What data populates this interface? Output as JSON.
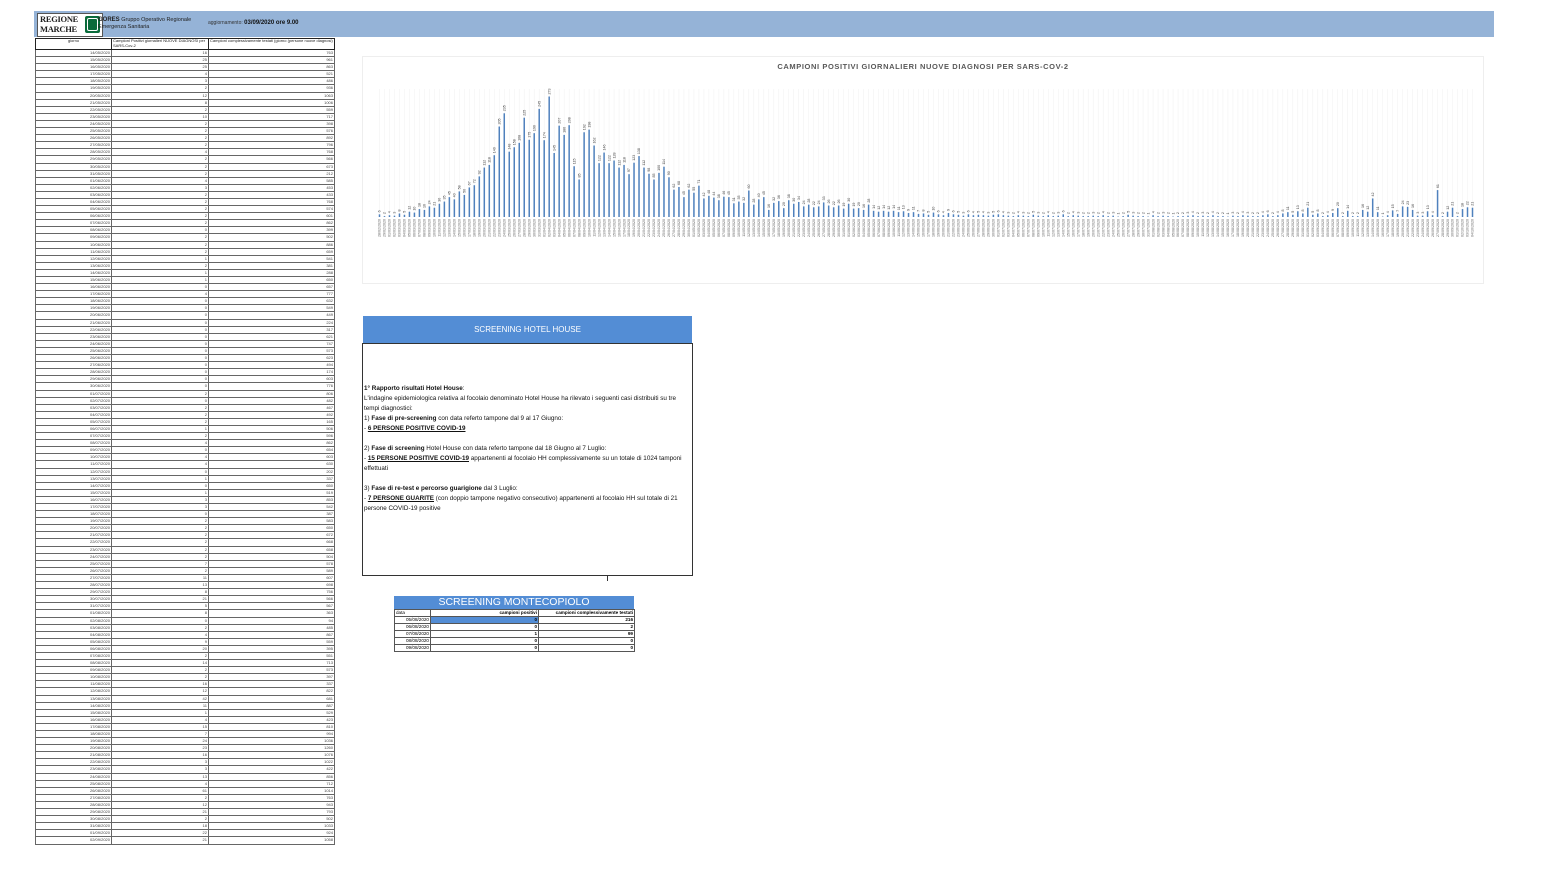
{
  "header": {
    "logo_line1": "REGIONE",
    "logo_line2": "MARCHE",
    "org_name": "GORES",
    "org_desc_1": "Gruppo Operativo Regionale",
    "org_desc_2": "Emergenza Sanitaria",
    "update_label": "aggiornamento:",
    "update_value": "03/09/2020 ore 9.00",
    "accent": "#95b3d7"
  },
  "daily_table": {
    "headers": [
      "giorno",
      "Campioni Positivi giornalieri NUOVE DIAGNOSI per SARS-Cov-2",
      "Campioni complessivamente testati (giorno (persone nuove diagnosi)"
    ],
    "rows": [
      [
        "14/05/2020",
        "16",
        "763"
      ],
      [
        "15/05/2020",
        "25",
        "961"
      ],
      [
        "16/05/2020",
        "25",
        "863"
      ],
      [
        "17/05/2020",
        "4",
        "521"
      ],
      [
        "18/05/2020",
        "3",
        "486"
      ],
      [
        "19/05/2020",
        "2",
        "936"
      ],
      [
        "20/05/2020",
        "12",
        "1063"
      ],
      [
        "21/05/2020",
        "8",
        "1006"
      ],
      [
        "22/05/2020",
        "2",
        "559"
      ],
      [
        "23/05/2020",
        "10",
        "717"
      ],
      [
        "24/05/2020",
        "2",
        "398"
      ],
      [
        "25/05/2020",
        "2",
        "576"
      ],
      [
        "26/05/2020",
        "2",
        "892"
      ],
      [
        "27/05/2020",
        "2",
        "796"
      ],
      [
        "28/05/2020",
        "4",
        "768"
      ],
      [
        "29/05/2020",
        "2",
        "566"
      ],
      [
        "30/05/2020",
        "2",
        "673"
      ],
      [
        "31/05/2020",
        "2",
        "212"
      ],
      [
        "01/06/2020",
        "4",
        "585"
      ],
      [
        "02/06/2020",
        "3",
        "453"
      ],
      [
        "03/06/2020",
        "2",
        "433"
      ],
      [
        "04/06/2020",
        "2",
        "768"
      ],
      [
        "05/06/2020",
        "2",
        "574"
      ],
      [
        "06/06/2020",
        "2",
        "601"
      ],
      [
        "07/06/2020",
        "2",
        "862"
      ],
      [
        "08/06/2020",
        "0",
        "399"
      ],
      [
        "09/06/2020",
        "2",
        "502"
      ],
      [
        "10/06/2020",
        "2",
        "886"
      ],
      [
        "11/06/2020",
        "2",
        "659"
      ],
      [
        "12/06/2020",
        "1",
        "541"
      ],
      [
        "13/06/2020",
        "2",
        "381"
      ],
      [
        "14/06/2020",
        "1",
        "288"
      ],
      [
        "15/06/2020",
        "1",
        "650"
      ],
      [
        "16/06/2020",
        "0",
        "657"
      ],
      [
        "17/06/2020",
        "4",
        "777"
      ],
      [
        "18/06/2020",
        "0",
        "632"
      ],
      [
        "19/06/2020",
        "0",
        "549"
      ],
      [
        "20/06/2020",
        "0",
        "449"
      ],
      [
        "21/06/2020",
        "0",
        "224"
      ],
      [
        "22/06/2020",
        "0",
        "317"
      ],
      [
        "23/06/2020",
        "0",
        "621"
      ],
      [
        "24/06/2020",
        "0",
        "747"
      ],
      [
        "25/06/2020",
        "0",
        "573"
      ],
      [
        "26/06/2020",
        "0",
        "623"
      ],
      [
        "27/06/2020",
        "0",
        "494"
      ],
      [
        "28/06/2020",
        "0",
        "174"
      ],
      [
        "29/06/2020",
        "0",
        "603"
      ],
      [
        "30/06/2020",
        "0",
        "776"
      ],
      [
        "01/07/2020",
        "2",
        "806"
      ],
      [
        "02/07/2020",
        "0",
        "482"
      ],
      [
        "03/07/2020",
        "2",
        "467"
      ],
      [
        "04/07/2020",
        "2",
        "492"
      ],
      [
        "05/07/2020",
        "2",
        "165"
      ],
      [
        "06/07/2020",
        "1",
        "506"
      ],
      [
        "07/07/2020",
        "2",
        "596"
      ],
      [
        "08/07/2020",
        "4",
        "862"
      ],
      [
        "09/07/2020",
        "0",
        "654"
      ],
      [
        "10/07/2020",
        "4",
        "603"
      ],
      [
        "11/07/2020",
        "4",
        "630"
      ],
      [
        "12/07/2020",
        "0",
        "202"
      ],
      [
        "13/07/2020",
        "1",
        "337"
      ],
      [
        "14/07/2020",
        "0",
        "650"
      ],
      [
        "15/07/2020",
        "1",
        "519"
      ],
      [
        "16/07/2020",
        "3",
        "853"
      ],
      [
        "17/07/2020",
        "3",
        "542"
      ],
      [
        "18/07/2020",
        "0",
        "387"
      ],
      [
        "19/07/2020",
        "2",
        "583"
      ],
      [
        "20/07/2020",
        "2",
        "650"
      ],
      [
        "21/07/2020",
        "2",
        "672"
      ],
      [
        "22/07/2020",
        "2",
        "668"
      ],
      [
        "23/07/2020",
        "2",
        "658"
      ],
      [
        "24/07/2020",
        "2",
        "504"
      ],
      [
        "25/07/2020",
        "7",
        "578"
      ],
      [
        "26/07/2020",
        "2",
        "589"
      ],
      [
        "27/07/2020",
        "11",
        "607"
      ],
      [
        "28/07/2020",
        "13",
        "698"
      ],
      [
        "29/07/2020",
        "8",
        "756"
      ],
      [
        "30/07/2020",
        "21",
        "566"
      ],
      [
        "31/07/2020",
        "5",
        "567"
      ],
      [
        "01/08/2020",
        "8",
        "363"
      ],
      [
        "02/08/2020",
        "0",
        "94"
      ],
      [
        "03/08/2020",
        "2",
        "485"
      ],
      [
        "04/08/2020",
        "4",
        "867"
      ],
      [
        "05/08/2020",
        "9",
        "559"
      ],
      [
        "06/08/2020",
        "20",
        "395"
      ],
      [
        "07/08/2020",
        "2",
        "551"
      ],
      [
        "08/08/2020",
        "14",
        "713"
      ],
      [
        "09/08/2020",
        "2",
        "573"
      ],
      [
        "10/08/2020",
        "2",
        "397"
      ],
      [
        "11/08/2020",
        "16",
        "337"
      ],
      [
        "12/08/2020",
        "12",
        "822"
      ],
      [
        "13/08/2020",
        "42",
        "681"
      ],
      [
        "14/08/2020",
        "11",
        "887"
      ],
      [
        "15/08/2020",
        "1",
        "529"
      ],
      [
        "16/08/2020",
        "4",
        "423"
      ],
      [
        "17/08/2020",
        "15",
        "810"
      ],
      [
        "18/08/2020",
        "7",
        "994"
      ],
      [
        "19/08/2020",
        "24",
        "1036"
      ],
      [
        "20/08/2020",
        "23",
        "1260"
      ],
      [
        "21/08/2020",
        "16",
        "1076"
      ],
      [
        "22/08/2020",
        "3",
        "1022"
      ],
      [
        "23/08/2020",
        "3",
        "422"
      ],
      [
        "24/08/2020",
        "13",
        "856"
      ],
      [
        "25/08/2020",
        "4",
        "712"
      ],
      [
        "26/08/2020",
        "61",
        "1014"
      ],
      [
        "27/08/2020",
        "2",
        "763"
      ],
      [
        "28/08/2020",
        "12",
        "943"
      ],
      [
        "29/08/2020",
        "21",
        "793"
      ],
      [
        "30/08/2020",
        "2",
        "502"
      ],
      [
        "31/08/2020",
        "18",
        "1033"
      ],
      [
        "01/09/2020",
        "22",
        "924"
      ],
      [
        "02/09/2020",
        "21",
        "1058"
      ]
    ]
  },
  "chart_data": {
    "type": "bar",
    "title": "CAMPIONI POSITIVI GIORNALIERI NUOVE DIAGNOSI PER SARS-COV-2",
    "x_start": "28/02/2020",
    "x_end": "02/09/2020",
    "values": [
      6,
      2,
      4,
      3,
      8,
      5,
      12,
      10,
      18,
      16,
      24,
      21,
      30,
      35,
      45,
      40,
      58,
      50,
      67,
      72,
      92,
      112,
      118,
      140,
      205,
      235,
      148,
      158,
      168,
      225,
      175,
      190,
      245,
      174,
      273,
      145,
      207,
      186,
      208,
      115,
      85,
      192,
      198,
      162,
      122,
      146,
      122,
      128,
      112,
      118,
      97,
      123,
      138,
      112,
      98,
      85,
      100,
      114,
      90,
      62,
      68,
      45,
      62,
      55,
      71,
      42,
      48,
      44,
      38,
      46,
      45,
      31,
      35,
      32,
      60,
      28,
      40,
      45,
      16,
      32,
      36,
      20,
      38,
      30,
      34,
      24,
      28,
      22,
      24,
      33,
      26,
      22,
      26,
      19,
      30,
      19,
      20,
      16,
      28,
      14,
      12,
      14,
      12,
      14,
      11,
      13,
      9,
      11,
      7,
      8,
      5,
      10,
      6,
      4,
      9,
      6,
      5,
      3,
      6,
      4,
      5,
      4,
      3,
      5,
      6,
      4,
      3,
      2,
      4,
      3,
      2,
      5,
      3,
      2,
      4,
      2,
      3,
      6,
      2,
      4,
      3,
      2,
      2,
      3,
      2,
      4,
      2,
      3,
      1,
      2,
      5,
      3,
      2,
      2,
      1,
      4,
      2,
      3,
      2,
      1,
      2,
      2,
      3,
      4,
      2,
      3,
      2,
      4,
      2,
      2,
      1,
      3,
      2,
      4,
      3,
      2,
      2,
      4,
      6,
      2,
      4,
      8,
      11,
      5,
      13,
      8,
      21,
      5,
      8,
      2,
      4,
      9,
      20,
      2,
      14,
      2,
      2,
      16,
      12,
      42,
      11,
      1,
      4,
      15,
      7,
      24,
      23,
      16,
      3,
      3,
      13,
      4,
      61,
      2,
      12,
      21,
      2,
      18,
      22,
      21
    ],
    "ylim": [
      0,
      290
    ],
    "xlabel": "",
    "ylabel": "",
    "color": "#4f81bd"
  },
  "hotel_house": {
    "title": "SCREENING HOTEL HOUSE",
    "heading": "1° Rapporto  risultati Hotel House",
    "heading_suffix": ":",
    "intro": "L'indagine epidemiologica relativa al focolaio denominato Hotel House ha rilevato i seguenti casi distribuiti su tre tempi diagnostici:",
    "p1_prefix": "1) ",
    "p1_bold": "Fase di pre-screening",
    "p1_rest": " con data referto tampone dal 9 al 17 Giugno:",
    "p1_item_prefix": "- ",
    "p1_item": "6 PERSONE POSITIVE COVID-19",
    "p2_prefix": "2) ",
    "p2_bold": "Fase di screening",
    "p2_rest": " Hotel House con data referto tampone dal 18 Giugno al 7 Luglio:",
    "p2_item_prefix": "- ",
    "p2_item": "15 PERSONE POSITIVE COVID-19",
    "p2_item_rest": " appartenenti al focolaio HH complessivamente su un totale di 1024 tamponi effettuati",
    "p3_prefix": "3) ",
    "p3_bold": "Fase di re-test e percorso guarigione",
    "p3_rest": " dal 3 Luglio:",
    "p3_item_prefix": "- ",
    "p3_item": "7 PERSONE GUARITE",
    "p3_item_rest": " (con doppio tampone negativo consecutivo) appartenenti al focolaio HH sul totale di 21 persone COVID-19 positive",
    "accent": "#538dd5"
  },
  "montecopiolo": {
    "title": "SCREENING MONTECOPIOLO",
    "headers": [
      "data",
      "campioni positivi",
      "campioni complessivamente testati"
    ],
    "rows": [
      [
        "05/08/2020",
        "0",
        "216"
      ],
      [
        "06/08/2020",
        "0",
        "2"
      ],
      [
        "07/08/2020",
        "1",
        "99"
      ],
      [
        "08/08/2020",
        "0",
        "0"
      ],
      [
        "09/08/2020",
        "0",
        "0"
      ]
    ]
  }
}
